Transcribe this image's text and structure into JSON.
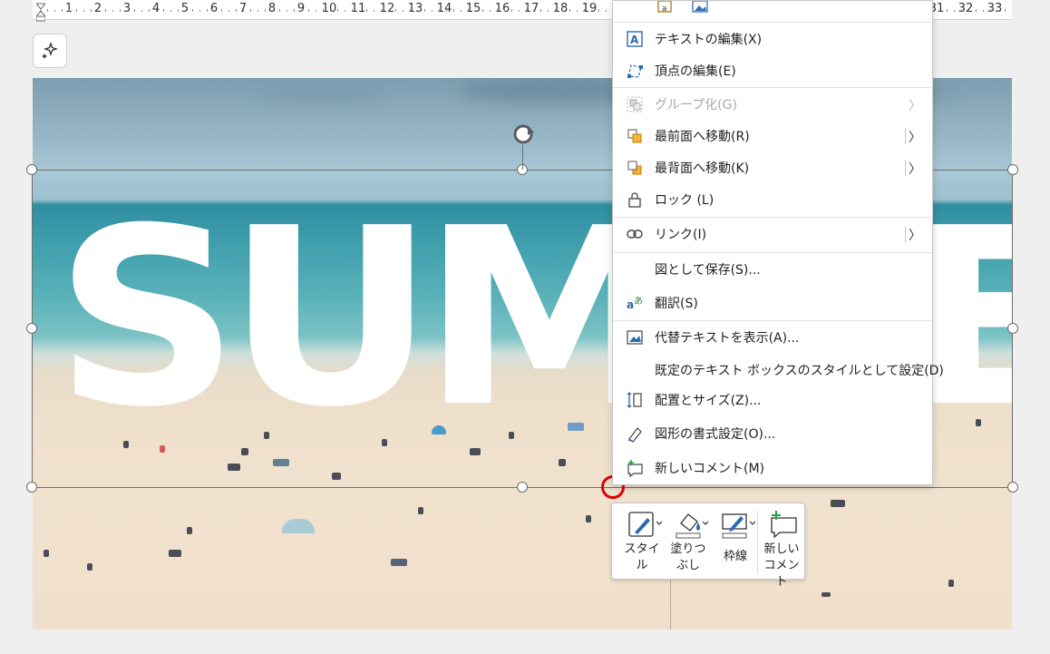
{
  "ruler": {
    "numbers": [
      "1",
      "2",
      "3",
      "4",
      "5",
      "6",
      "7",
      "8",
      "9",
      "10",
      "11",
      "12",
      "13",
      "14",
      "15",
      "16",
      "17",
      "18",
      "19",
      "31",
      "32",
      "33"
    ]
  },
  "canvas": {
    "word_art": "SUMMER"
  },
  "context_menu": {
    "items": [
      {
        "label": "テキストの編集(X)",
        "icon": "text-edit-icon",
        "disabled": false,
        "submenu": false
      },
      {
        "label": "頂点の編集(E)",
        "icon": "edit-points-icon",
        "disabled": false,
        "submenu": false
      },
      {
        "label": "グループ化(G)",
        "icon": "group-icon",
        "disabled": true,
        "submenu": true
      },
      {
        "label": "最前面へ移動(R)",
        "icon": "bring-front-icon",
        "disabled": false,
        "submenu": true
      },
      {
        "label": "最背面へ移動(K)",
        "icon": "send-back-icon",
        "disabled": false,
        "submenu": true
      },
      {
        "label": "ロック (L)",
        "icon": "lock-icon",
        "disabled": false,
        "submenu": false
      },
      {
        "label": "リンク(I)",
        "icon": "link-icon",
        "disabled": false,
        "submenu": true
      },
      {
        "label": "図として保存(S)...",
        "icon": "",
        "disabled": false,
        "submenu": false
      },
      {
        "label": "翻訳(S)",
        "icon": "translate-icon",
        "disabled": false,
        "submenu": false
      },
      {
        "label": "代替テキストを表示(A)...",
        "icon": "alt-text-icon",
        "disabled": false,
        "submenu": false
      },
      {
        "label": "既定のテキスト ボックスのスタイルとして設定(D)",
        "icon": "",
        "disabled": false,
        "submenu": false
      },
      {
        "label": "配置とサイズ(Z)...",
        "icon": "size-position-icon",
        "disabled": false,
        "submenu": false
      },
      {
        "label": "図形の書式設定(O)...",
        "icon": "format-shape-icon",
        "disabled": false,
        "submenu": false,
        "highlighted": true
      },
      {
        "label": "新しいコメント(M)",
        "icon": "new-comment-icon",
        "disabled": false,
        "submenu": false
      }
    ],
    "highlight_color": "#e50000"
  },
  "mini_toolbar": {
    "style_label": "スタイル",
    "fill_label": "塗りつぶし",
    "outline_label": "枠線",
    "comment_label": "新しいコメント"
  }
}
